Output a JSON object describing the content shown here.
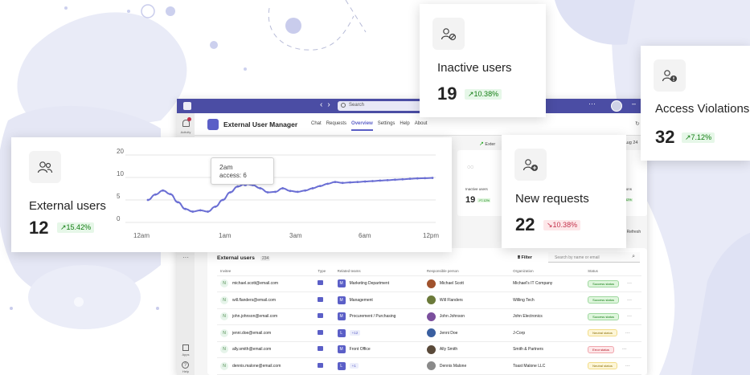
{
  "teams_window": {
    "search_placeholder": "Search",
    "rail": {
      "activity": "Activity",
      "apps": "Apps",
      "help": "Help"
    },
    "app_title": "External User Manager",
    "tabs": [
      {
        "label": "Chat",
        "active": false
      },
      {
        "label": "Requests",
        "active": false
      },
      {
        "label": "Overview",
        "active": true
      },
      {
        "label": "Settings",
        "active": false
      },
      {
        "label": "Help",
        "active": false
      },
      {
        "label": "About",
        "active": false
      }
    ],
    "subbar": {
      "link": "Exter",
      "date": "Aug 24"
    },
    "mini_inactive": {
      "label": "Inactive users",
      "value": "19",
      "delta": "7.12%"
    },
    "mini_violations": {
      "label": "ations",
      "delta": "7.12%"
    },
    "refresh": "Refresh",
    "panel": {
      "title": "External users",
      "count": "234",
      "filter": "Filter",
      "search_placeholder": "Search by name or email",
      "columns": [
        "Invitee",
        "Type",
        "Related teams",
        "Responsible person",
        "Organization",
        "Status"
      ],
      "rows": [
        {
          "email": "michael.scott@email.com",
          "team_letter": "M",
          "team": "Marketing Department",
          "person": "Michael Scott",
          "org": "Michael's IT Company",
          "status": "Success status",
          "status_kind": "success",
          "avatar_color": "#a0522d"
        },
        {
          "email": "will.flanders@email.com",
          "team_letter": "M",
          "team": "Management",
          "person": "Will Flanders",
          "org": "Willing Tech",
          "status": "Success status",
          "status_kind": "success",
          "avatar_color": "#6b7a3a"
        },
        {
          "email": "john.johnson@email.com",
          "team_letter": "M",
          "team": "Procurement / Purchasing",
          "person": "John Johnson",
          "org": "John Electronics",
          "status": "Success status",
          "status_kind": "success",
          "avatar_color": "#7b4f9d"
        },
        {
          "email": "jenni.doe@email.com",
          "team_letter": "L",
          "team": "+12",
          "person": "Jenni Doe",
          "org": "J-Corp",
          "status": "Neutral status",
          "status_kind": "neutral",
          "avatar_color": "#3a5fa0"
        },
        {
          "email": "ally.smith@email.com",
          "team_letter": "M",
          "team": "Front Office",
          "person": "Ally Smith",
          "org": "Smith & Partners",
          "status": "Error status",
          "status_kind": "error",
          "avatar_color": "#5a4a3a"
        },
        {
          "email": "dennis.malone@email.com",
          "team_letter": "L",
          "team": "+1",
          "person": "Dennis Malone",
          "org": "Toast Malone LLC",
          "status": "Neutral status",
          "status_kind": "neutral",
          "avatar_color": "#8a8a8a"
        }
      ]
    }
  },
  "cards": {
    "external": {
      "label": "External users",
      "value": "12",
      "delta": "15.42%",
      "trend": "up"
    },
    "inactive": {
      "label": "Inactive users",
      "value": "19",
      "delta": "10.38%",
      "trend": "up"
    },
    "new_requests": {
      "label": "New requests",
      "value": "22",
      "delta": "10.38%",
      "trend": "down"
    },
    "violations": {
      "label": "Access Violations",
      "value": "32",
      "delta": "7.12%",
      "trend": "up"
    }
  },
  "tooltip": {
    "time": "2am",
    "text": "access: 6"
  },
  "colors": {
    "accent": "#5b5fc7",
    "line": "#6b6fd4",
    "up": "#107c10",
    "down": "#c4314b"
  },
  "chart_data": {
    "type": "line",
    "title": "",
    "xlabel": "",
    "ylabel": "",
    "x_ticks": [
      "12am",
      "1am",
      "3am",
      "6am",
      "12pm"
    ],
    "y_ticks": [
      0,
      5,
      10,
      20
    ],
    "series": [
      {
        "values": [
          5,
          6.2,
          7.1,
          6.3,
          4.5,
          3,
          2.4,
          2.7,
          2.4,
          3.5,
          5,
          6.7,
          8,
          8.6,
          8.3,
          7.6,
          6.7,
          6.8,
          7.6,
          7,
          6.8,
          7.1,
          7.6,
          8.1,
          8.6,
          9,
          8.8,
          8.9,
          9,
          9.1,
          9.2,
          9.3,
          9.4,
          9.5,
          9.6,
          9.7,
          9.8,
          9.85,
          9.9
        ]
      }
    ]
  }
}
